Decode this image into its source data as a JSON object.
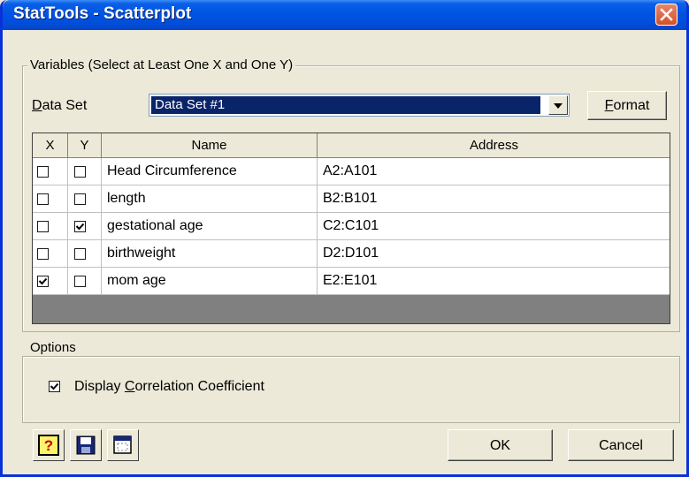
{
  "window": {
    "title": "StatTools - Scatterplot"
  },
  "variables_group": {
    "legend": "Variables (Select at Least One X and One Y)"
  },
  "data_set": {
    "label_first": "D",
    "label_rest": "ata Set",
    "selected": "Data Set #1",
    "format_first": "F",
    "format_rest": "ormat"
  },
  "grid": {
    "headers": {
      "x": "X",
      "y": "Y",
      "name": "Name",
      "address": "Address"
    },
    "rows": [
      {
        "x": false,
        "y": false,
        "name": "Head Circumference",
        "address": "A2:A101"
      },
      {
        "x": false,
        "y": false,
        "name": "length",
        "address": "B2:B101"
      },
      {
        "x": false,
        "y": true,
        "name": "gestational age",
        "address": "C2:C101"
      },
      {
        "x": false,
        "y": false,
        "name": "birthweight",
        "address": "D2:D101"
      },
      {
        "x": true,
        "y": false,
        "name": "mom age",
        "address": "E2:E101"
      }
    ]
  },
  "options_group": {
    "legend": "Options",
    "correlation": {
      "checked": true,
      "prefix": "Display ",
      "accel": "C",
      "rest": "orrelation Coefficient"
    }
  },
  "footer": {
    "ok_label": "OK",
    "cancel_label": "Cancel",
    "icons": [
      "help-icon",
      "save-icon",
      "window-icon"
    ]
  }
}
